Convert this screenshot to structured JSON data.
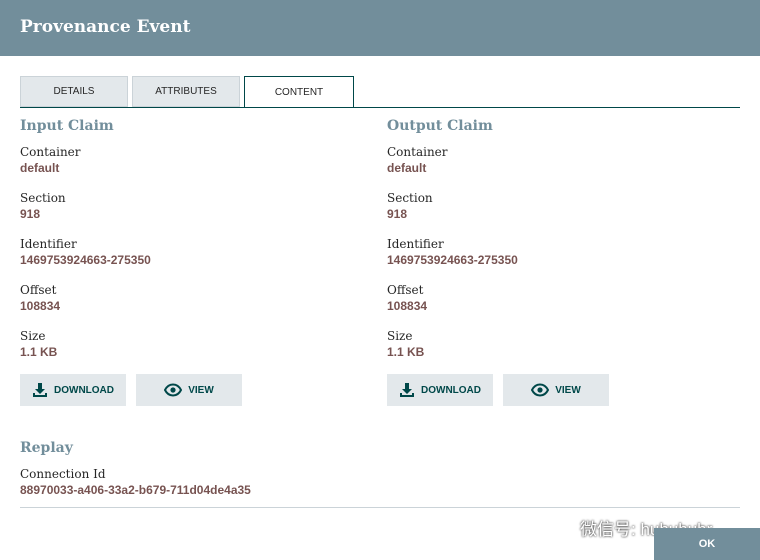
{
  "dialog": {
    "title": "Provenance Event"
  },
  "tabs": [
    {
      "label": "DETAILS"
    },
    {
      "label": "ATTRIBUTES"
    },
    {
      "label": "CONTENT"
    }
  ],
  "input_claim": {
    "title": "Input Claim",
    "container_label": "Container",
    "container_value": "default",
    "section_label": "Section",
    "section_value": "918",
    "identifier_label": "Identifier",
    "identifier_value": "1469753924663-275350",
    "offset_label": "Offset",
    "offset_value": "108834",
    "size_label": "Size",
    "size_value": "1.1 KB",
    "download_label": "DOWNLOAD",
    "view_label": "VIEW"
  },
  "output_claim": {
    "title": "Output Claim",
    "container_label": "Container",
    "container_value": "default",
    "section_label": "Section",
    "section_value": "918",
    "identifier_label": "Identifier",
    "identifier_value": "1469753924663-275350",
    "offset_label": "Offset",
    "offset_value": "108834",
    "size_label": "Size",
    "size_value": "1.1 KB",
    "download_label": "DOWNLOAD",
    "view_label": "VIEW"
  },
  "replay": {
    "title": "Replay",
    "connection_label": "Connection Id",
    "connection_value": "88970033-a406-33a2-b679-711d04de4a35"
  },
  "footer": {
    "ok_label": "OK"
  },
  "watermark": {
    "text": "微信号: huhuhuhr",
    "icon": "wechat-icon"
  },
  "colors": {
    "header": "#728e9b",
    "accent": "#004849",
    "value": "#775351",
    "button_bg": "#e3e8eb"
  }
}
